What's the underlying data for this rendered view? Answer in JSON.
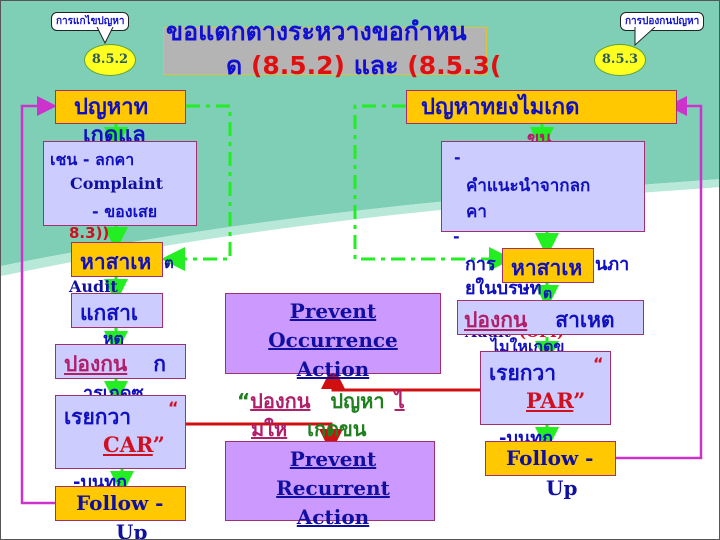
{
  "title": {
    "line1": "ขอแตกตางระหวางขอกำหน",
    "line2_prefix": "ด ",
    "ref_a": "(8.5.2)",
    "and": " และ ",
    "ref_b": "(8.5.3("
  },
  "left_callout": {
    "label": "การแกไขปญหา",
    "badge": "8.5.2"
  },
  "right_callout": {
    "label": "การปองกนปญหา",
    "badge": "8.5.3"
  },
  "left_flow": {
    "problem_box": "ปญหาท",
    "problem_overflow": "เกดแล",
    "examples_box": {
      "line1": "เชน    - ลกคา",
      "line2": "Complaint",
      "line3": "- ของเสย"
    },
    "ref_text": "8.3))",
    "find_cause_box": "หาสาเห",
    "find_cause_tail": "ต",
    "audit_text": "Audit",
    "fix_cause_box": "แกสาเ",
    "fix_overflow": "หต",
    "prevent_box": {
      "underlined": "ปองกน",
      "rest": "ก"
    },
    "prevent_overflow": "ารเกดซ",
    "called_box": {
      "prefix": "เรยกวา",
      "quote_open": "“",
      "acronym": "CAR",
      "quote_close": "”"
    },
    "record_text": "-บนทก",
    "follow_box": "Follow -",
    "follow_overflow": "Up"
  },
  "center": {
    "occurrence_box": {
      "line1": "Prevent",
      "line2": "Occurrence",
      "line3": "Action"
    },
    "caption": {
      "quote": "“",
      "prevent": "ปองกน",
      "problem": "ปญหา",
      "mark": "ไ",
      "not": "มให",
      "occur": "เกดขน"
    },
    "recurrent_box": {
      "line1": "Prevent",
      "line2": "Recurrent",
      "line3": "Action"
    }
  },
  "right_flow": {
    "problem_box": "ปญหาทยงไมเกด",
    "problem_overflow": "ขน",
    "suggest_box": {
      "bullet": "-",
      "line1": "คำแนะนำจากลก",
      "line2": "คา"
    },
    "bullet2": "-",
    "internal_text_a": "การ",
    "internal_text_b": "นภา",
    "internal_text_c": "ยในบรษท",
    "find_cause_box": "หาสาเห",
    "find_cause_tail": "ต",
    "audit_text": "Audit",
    "audit_code": "(OFI)",
    "prevent_box": {
      "underlined": "ปองกน",
      "rest": "สาเหต"
    },
    "prevent_overflow": "ไมใหเกดข",
    "called_box": {
      "prefix": "เรยกวา",
      "quote_open": "“",
      "acronym": "PAR",
      "quote_close": "”"
    },
    "record_text": "-บนทก",
    "follow_box": "Follow -",
    "follow_overflow": "Up"
  },
  "colors": {
    "teal_band": "#7ecfb6",
    "orange_box": "#ffc800",
    "lavender_box": "#ccccff",
    "purple_box": "#cc99ff",
    "arrow_green": "#22ee22",
    "line_red": "#d01010",
    "line_magenta": "#cc33cc",
    "text_blue": "#1010c0"
  }
}
